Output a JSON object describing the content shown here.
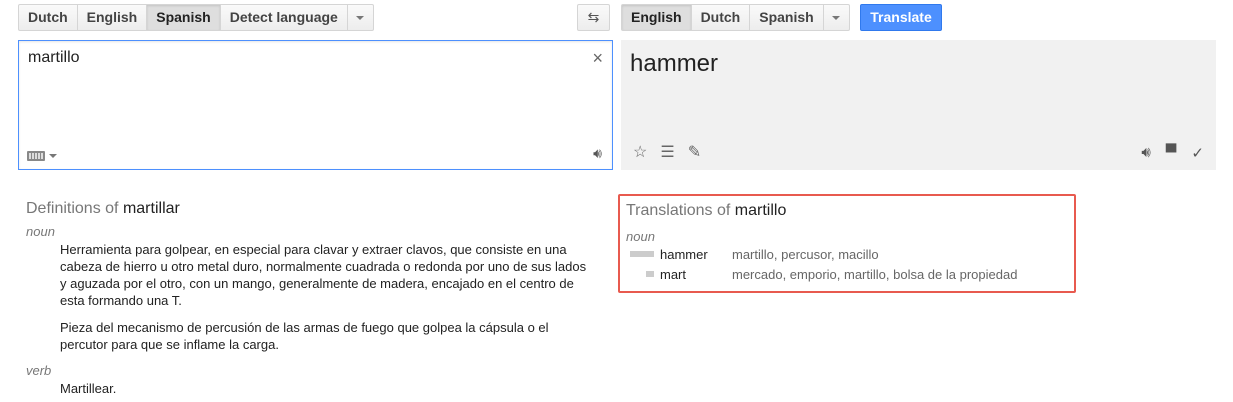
{
  "source_langs": {
    "items": [
      "Dutch",
      "English",
      "Spanish",
      "Detect language"
    ],
    "active_index": 2
  },
  "target_langs": {
    "items": [
      "English",
      "Dutch",
      "Spanish"
    ],
    "active_index": 0
  },
  "translate_label": "Translate",
  "source": {
    "text": "martillo",
    "clear_icon": "×"
  },
  "output": {
    "text": "hammer"
  },
  "definitions": {
    "title_prefix": "Definitions of",
    "word": "martillar",
    "groups": [
      {
        "pos": "noun",
        "defs": [
          "Herramienta para golpear, en especial para clavar y extraer clavos, que consiste en una cabeza de hierro u otro metal duro, normalmente cuadrada o redonda por uno de sus lados y aguzada por el otro, con un mango, generalmente de madera, encajado en el centro de esta formando una T.",
          "Pieza del mecanismo de percusión de las armas de fuego que golpea la cápsula o el percutor para que se inflame la carga."
        ]
      },
      {
        "pos": "verb",
        "defs": [
          "Martillear."
        ]
      }
    ]
  },
  "translations": {
    "title_prefix": "Translations of",
    "word": "martillo",
    "pos": "noun",
    "rows": [
      {
        "word": "hammer",
        "back": "martillo, percusor, macillo",
        "frequency": 1.0
      },
      {
        "word": "mart",
        "back": "mercado, emporio, martillo, bolsa de la propiedad",
        "frequency": 0.33
      }
    ]
  },
  "colors": {
    "accent": "#4d90fe",
    "highlight": "#e85a4f"
  }
}
